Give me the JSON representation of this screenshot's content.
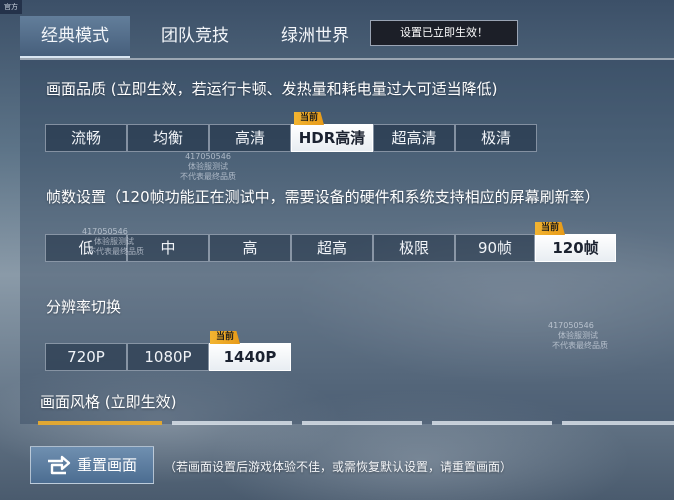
{
  "corner_badge": "官方",
  "tabs": [
    {
      "label": "经典模式",
      "active": true
    },
    {
      "label": "团队竞技",
      "active": false
    },
    {
      "label": "绿洲世界",
      "active": false
    }
  ],
  "notice": "设置已立即生效！",
  "current_tag": "当前",
  "quality": {
    "title": "画面品质 (立即生效，若运行卡顿、发热量和耗电量过大可适当降低)",
    "options": [
      "流畅",
      "均衡",
      "高清",
      "HDR高清",
      "超高清",
      "极清"
    ],
    "selected": "HDR高清"
  },
  "framerate": {
    "title": "帧数设置（120帧功能正在测试中，需要设备的硬件和系统支持相应的屏幕刷新率）",
    "options": [
      "低",
      "中",
      "高",
      "超高",
      "极限",
      "90帧",
      "120帧"
    ],
    "selected": "120帧"
  },
  "resolution": {
    "title": "分辨率切换",
    "options": [
      "720P",
      "1080P",
      "1440P"
    ],
    "selected": "1440P"
  },
  "style": {
    "title": "画面风格 (立即生效)"
  },
  "watermark": {
    "id": "417050546",
    "line1": "体验服测试",
    "line2": "不代表最终品质"
  },
  "reset_button": {
    "label": "重置画面",
    "icon": "reset-icon"
  },
  "bottom_hint": "（若画面设置后游戏体验不佳，或需恢复默认设置，请重置画面）",
  "colors": {
    "tag": "#f2b431",
    "selected_bg": "#ffffff",
    "button": "#5a7ba0"
  }
}
